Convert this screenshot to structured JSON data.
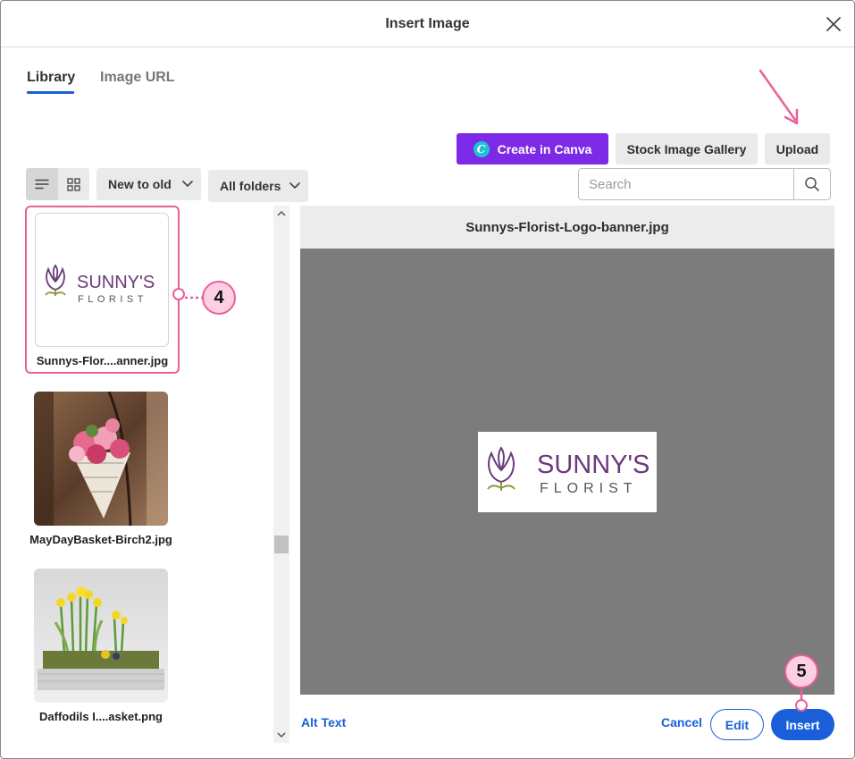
{
  "dialog": {
    "title": "Insert Image"
  },
  "tabs": [
    {
      "label": "Library",
      "active": true
    },
    {
      "label": "Image URL",
      "active": false
    }
  ],
  "toolbar": {
    "canva_label": "Create in Canva",
    "canva_badge": "C",
    "stock_label": "Stock Image Gallery",
    "upload_label": "Upload",
    "sort_label": "New to old",
    "folders_label": "All folders",
    "search_placeholder": "Search"
  },
  "images": [
    {
      "name": "Sunnys-Flor....anner.jpg",
      "selected": true
    },
    {
      "name": "MayDayBasket-Birch2.jpg",
      "selected": false
    },
    {
      "name": "Daffodils I....asket.png",
      "selected": false
    }
  ],
  "logo": {
    "line1": "SUNNY'S",
    "line2": "FLORIST"
  },
  "preview": {
    "filename": "Sunnys-Florist-Logo-banner.jpg"
  },
  "footer": {
    "alt_text_label": "Alt Text",
    "cancel_label": "Cancel",
    "edit_label": "Edit",
    "insert_label": "Insert"
  },
  "callouts": {
    "step4": "4",
    "step5": "5"
  },
  "colors": {
    "accent": "#1a5fd9",
    "canva": "#7d2ae8",
    "annotation": "#e8609a",
    "logo_purple": "#6b3a7a"
  }
}
